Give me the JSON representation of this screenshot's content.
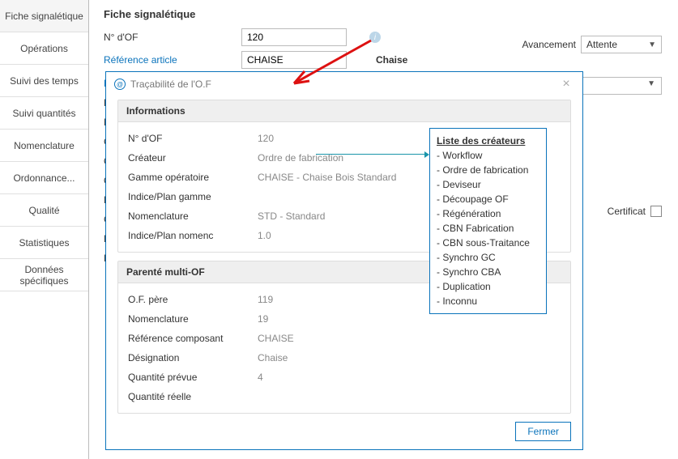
{
  "tabs": {
    "fiche": "Fiche signalétique",
    "operations": "Opérations",
    "suivi_temps": "Suivi des temps",
    "suivi_quantites": "Suivi quantités",
    "nomenclature": "Nomenclature",
    "ordonnance": "Ordonnance...",
    "qualite": "Qualité",
    "statistiques": "Statistiques",
    "donnees": "Données spécifiques"
  },
  "header": {
    "title": "Fiche signalétique",
    "of_label": "N° d'OF",
    "of_value": "120",
    "ref_label": "Référence article",
    "ref_value": "CHAISE",
    "ref_desc": "Chaise",
    "avancement_label": "Avancement",
    "avancement_value": "Attente",
    "certificat_label": "Certificat"
  },
  "trunc": {
    "a": "N° d",
    "b": "N° d",
    "c": "N° d",
    "d": "Clie",
    "e": "Qu",
    "f": "Qu",
    "g": "Res",
    "h": "Cou",
    "i": "Des",
    "j": "Ren"
  },
  "modal": {
    "title": "Traçabilité de l'O.F",
    "informations": {
      "head": "Informations",
      "rows": [
        {
          "label": "N° d'OF",
          "value": "120"
        },
        {
          "label": "Créateur",
          "value": "Ordre de fabrication"
        },
        {
          "label": "Gamme opératoire",
          "value": "CHAISE - Chaise Bois Standard"
        },
        {
          "label": "Indice/Plan gamme",
          "value": ""
        },
        {
          "label": "Nomenclature",
          "value": "STD - Standard"
        },
        {
          "label": "Indice/Plan nomenc",
          "value": "1.0"
        }
      ]
    },
    "parente": {
      "head": "Parenté multi-OF",
      "rows": [
        {
          "label": "O.F. père",
          "value": "119"
        },
        {
          "label": "Nomenclature",
          "value": "19"
        },
        {
          "label": "Référence composant",
          "value": "CHAISE"
        },
        {
          "label": "Désignation",
          "value": "Chaise"
        },
        {
          "label": "Quantité prévue",
          "value": "4"
        },
        {
          "label": "Quantité réelle",
          "value": ""
        }
      ]
    },
    "close": "Fermer"
  },
  "creators": {
    "title": "Liste des créateurs",
    "items": [
      "Workflow",
      "Ordre de fabrication",
      "Deviseur",
      "Découpage OF",
      "Régénération",
      "CBN Fabrication",
      "CBN sous-Traitance",
      "Synchro GC",
      "Synchro CBA",
      "Duplication",
      "Inconnu"
    ]
  }
}
